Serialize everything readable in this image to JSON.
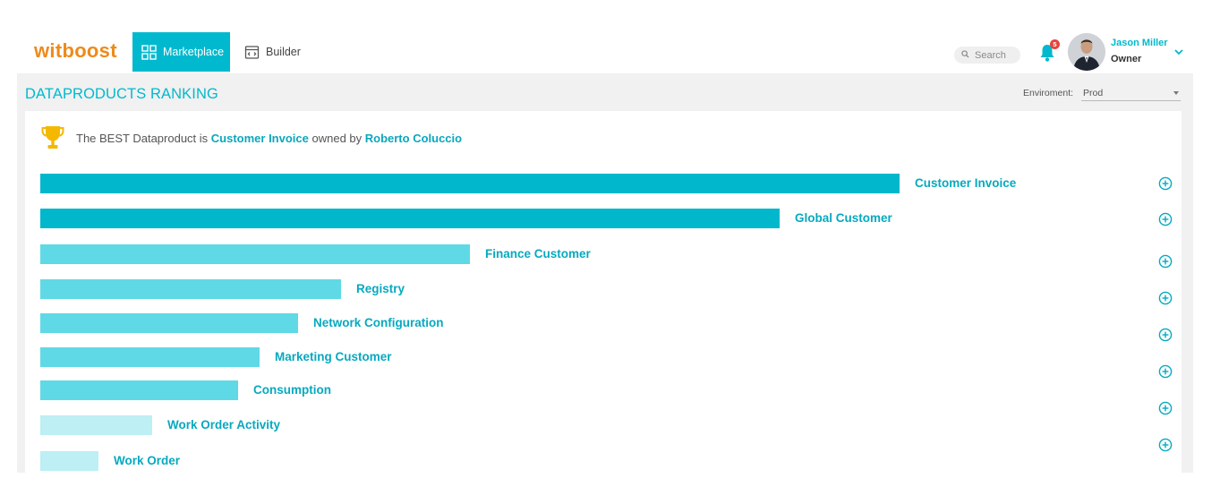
{
  "header": {
    "logo": "witboost",
    "tabs": [
      {
        "label": "Marketplace",
        "active": true
      },
      {
        "label": "Builder",
        "active": false
      }
    ],
    "search_placeholder": "Search",
    "notifications_count": "5",
    "user": {
      "name": "Jason Miller",
      "role": "Owner"
    }
  },
  "page": {
    "title": "DATAPRODUCTS RANKING",
    "environment_label": "Enviroment:",
    "environment_value": "Prod"
  },
  "best": {
    "prefix": "The BEST Dataproduct is ",
    "product": "Customer Invoice",
    "middle": " owned by ",
    "owner": "Roberto Coluccio"
  },
  "ranking": {
    "scale_max": 100,
    "items": [
      {
        "name": "Customer Invoice",
        "score": 100,
        "tier": "high"
      },
      {
        "name": "Global Customer",
        "score": 86,
        "tier": "high"
      },
      {
        "name": "Finance Customer",
        "score": 50,
        "tier": "mid"
      },
      {
        "name": "Registry",
        "score": 35,
        "tier": "mid"
      },
      {
        "name": "Network Configuration",
        "score": 30,
        "tier": "mid"
      },
      {
        "name": "Marketing Customer",
        "score": 25.5,
        "tier": "mid"
      },
      {
        "name": "Consumption",
        "score": 23,
        "tier": "mid"
      },
      {
        "name": "Work Order Activity",
        "score": 13,
        "tier": "low"
      },
      {
        "name": "Work Order",
        "score": 6.8,
        "tier": "low"
      }
    ]
  },
  "colors": {
    "accent": "#00b9ce",
    "logo": "#ee8a1b",
    "bar_high": "#00b7cc",
    "bar_mid": "#5fd9e5",
    "bar_low": "#bdeff4",
    "trophy": "#f5b800"
  }
}
